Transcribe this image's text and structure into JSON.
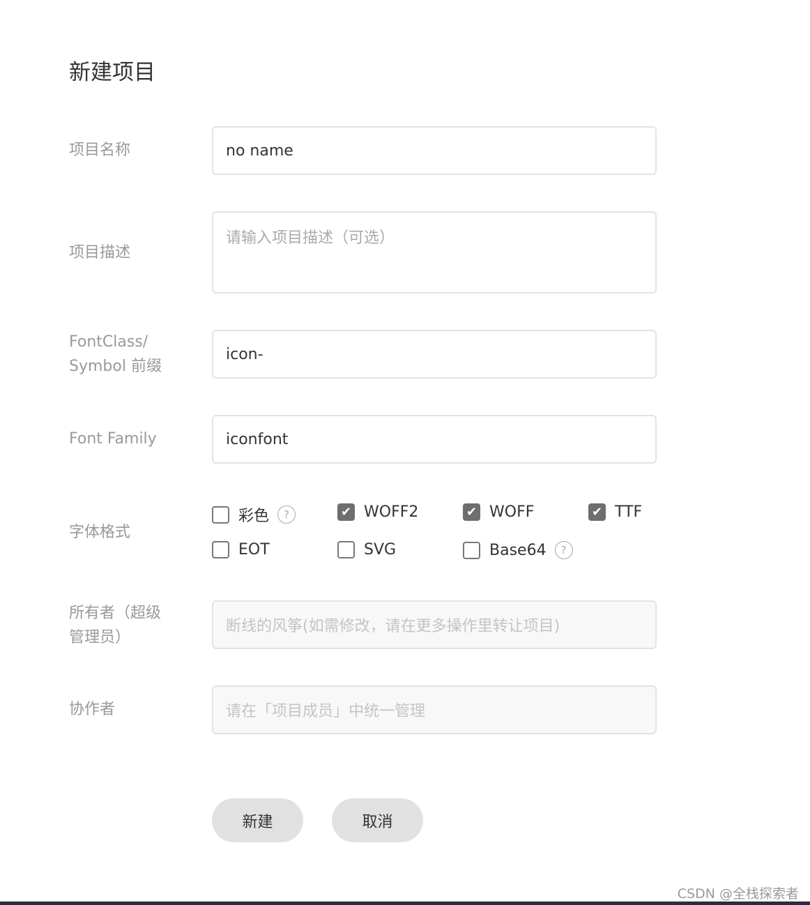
{
  "title": "新建项目",
  "fields": {
    "name": {
      "label": "项目名称",
      "value": "no name"
    },
    "desc": {
      "label": "项目描述",
      "placeholder": "请输入项目描述（可选）"
    },
    "prefix": {
      "label1": "FontClass/",
      "label2": "Symbol 前缀",
      "value": "icon-"
    },
    "family": {
      "label": "Font Family",
      "value": "iconfont"
    },
    "formats": {
      "label": "字体格式",
      "options": [
        {
          "label": "彩色",
          "checked": false,
          "help": "?"
        },
        {
          "label": "WOFF2",
          "checked": true
        },
        {
          "label": "WOFF",
          "checked": true
        },
        {
          "label": "TTF",
          "checked": true
        },
        {
          "label": "EOT",
          "checked": false
        },
        {
          "label": "SVG",
          "checked": false
        },
        {
          "label": "Base64",
          "checked": false,
          "help": "?"
        }
      ]
    },
    "owner": {
      "label1": "所有者（超级",
      "label2": "管理员）",
      "value": "断线的风筝(如需修改，请在更多操作里转让项目)"
    },
    "collab": {
      "label": "协作者",
      "value": "请在「项目成员」中统一管理"
    }
  },
  "buttons": {
    "create": "新建",
    "cancel": "取消"
  },
  "watermark": "CSDN @全栈探索者"
}
